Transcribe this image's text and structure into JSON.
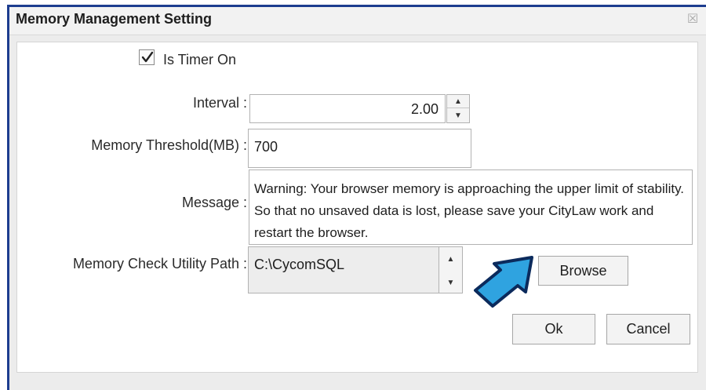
{
  "window": {
    "title": "Memory Management Setting",
    "close_glyph": "☒"
  },
  "form": {
    "timer_checkbox": {
      "label": "Is Timer On",
      "checked": true
    },
    "interval": {
      "label": "Interval :",
      "value": "2.00"
    },
    "threshold": {
      "label": "Memory Threshold(MB)  :",
      "value": "700"
    },
    "message": {
      "label": "Message :",
      "value": "Warning:  Your browser memory is approaching the upper limit of stability.  So that no unsaved data is lost, please save your CityLaw work and restart the browser."
    },
    "path": {
      "label": "Memory Check Utility Path  :",
      "value": "C:\\CycomSQL"
    },
    "browse_label": "Browse"
  },
  "buttons": {
    "ok_label": "Ok",
    "cancel_label": "Cancel"
  },
  "icons": {
    "checkmark": "checkmark-icon",
    "spin_up": "arrow-up-icon",
    "spin_down": "arrow-down-icon",
    "pointer_arrow": "pointer-arrow-icon"
  },
  "colors": {
    "window_border": "#1d3d8f",
    "arrow_fill": "#2fa3e0",
    "arrow_stroke": "#0b2a5c"
  }
}
